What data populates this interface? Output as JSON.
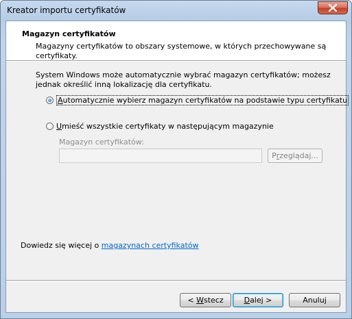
{
  "window": {
    "title": "Kreator importu certyfikatów"
  },
  "header": {
    "title": "Magazyn certyfikatów",
    "description": "Magazyny certyfikatów to obszary systemowe, w których przechowywane są certyfikaty."
  },
  "content": {
    "intro": "System Windows może automatycznie wybrać magazyn certyfikatów; możesz jednak określić inną lokalizację dla certyfikatu.",
    "option_auto": {
      "mnemonic": "A",
      "rest": "utomatycznie wybierz magazyn certyfikatów na podstawie typu certyfikatu",
      "checked": true
    },
    "option_manual": {
      "mnemonic": "U",
      "rest": "mieść wszystkie certyfikaty w następującym magazynie",
      "checked": false
    },
    "store_label": "Magazyn certyfikatów:",
    "store_value": "",
    "browse": {
      "mnemonic": "r",
      "before": "P",
      "after": "zeglądaj..."
    },
    "learn_more_prefix": "Dowiedz się więcej o ",
    "learn_more_link": "magazynach certyfikatów"
  },
  "buttons": {
    "back": {
      "before": "< ",
      "mnemonic": "W",
      "after": "stecz"
    },
    "next": {
      "mnemonic": "D",
      "after": "alej >"
    },
    "cancel": {
      "label": "Anuluj"
    }
  },
  "colors": {
    "link": "#0066cc",
    "close_button": "#c4412a",
    "window_frame": "#b9d0e9"
  }
}
